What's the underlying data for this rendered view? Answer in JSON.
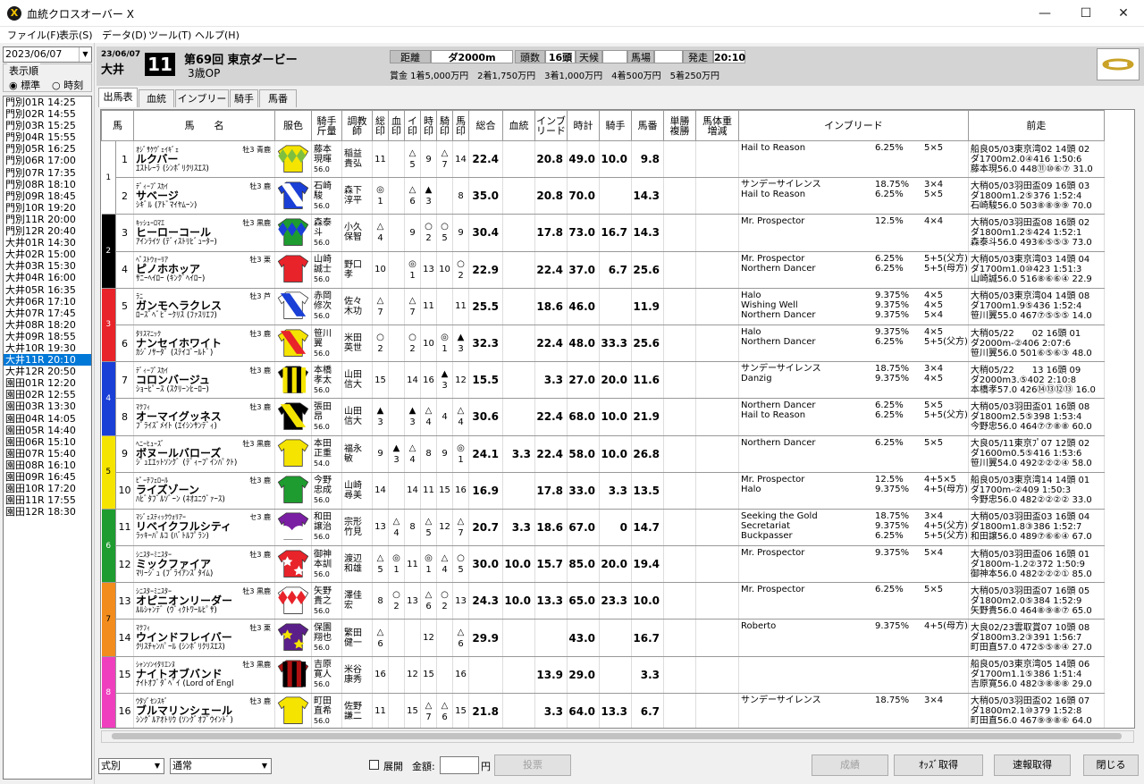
{
  "window": {
    "title": "血統クロスオーバー X",
    "minimize": "—",
    "maximize": "☐",
    "close": "✕"
  },
  "menu": [
    "ファイル(F)",
    "表示(S)",
    "データ(D)",
    "ツール(T)",
    "ヘルプ(H)"
  ],
  "left": {
    "date": "2023/06/07",
    "order_label": "表示順",
    "order_opts": [
      "標準",
      "時刻"
    ],
    "races": [
      "門別01R 14:25",
      "門別02R 14:55",
      "門別03R 15:25",
      "門別04R 15:55",
      "門別05R 16:25",
      "門別06R 17:00",
      "門別07R 17:35",
      "門別08R 18:10",
      "門別09R 18:45",
      "門別10R 19:20",
      "門別11R 20:00",
      "門別12R 20:40",
      "大井01R 14:30",
      "大井02R 15:00",
      "大井03R 15:30",
      "大井04R 16:00",
      "大井05R 16:35",
      "大井06R 17:10",
      "大井07R 17:45",
      "大井08R 18:20",
      "大井09R 18:55",
      "大井10R 19:30",
      "大井11R 20:10",
      "大井12R 20:50",
      "園田01R 12:20",
      "園田02R 12:55",
      "園田03R 13:30",
      "園田04R 14:05",
      "園田05R 14:40",
      "園田06R 15:10",
      "園田07R 15:40",
      "園田08R 16:10",
      "園田09R 16:45",
      "園田10R 17:20",
      "園田11R 17:55",
      "園田12R 18:30"
    ],
    "selected": 22
  },
  "race": {
    "date": "23/06/07",
    "venue": "大井",
    "no": "11",
    "name": "第69回 東京ダービー",
    "class": "3歳OP",
    "labels": {
      "dist": "距離",
      "heads": "頭数",
      "weather": "天候",
      "track": "馬場",
      "start": "発走"
    },
    "dist": "ダ2000m",
    "heads": "16頭",
    "weather": "",
    "track": "",
    "start": "20:10",
    "prize": "賞金 1着5,000万円　2着1,750万円　3着1,000万円　4着500万円　5着250万円"
  },
  "tabs": [
    "出馬表",
    "血統",
    "インブリード",
    "騎手",
    "馬番"
  ],
  "headers": [
    "馬",
    "馬　　名",
    "服色",
    "騎手\n斤量",
    "調教\n師",
    "総\n印",
    "血\n印",
    "イ\n印",
    "時\n印",
    "騎\n印",
    "馬\n印",
    "総合",
    "血統",
    "インブ\nリード",
    "時計",
    "騎手",
    "馬番",
    "単勝\n複勝",
    "馬体重\n増減",
    "インブリード",
    "前走"
  ],
  "gates": [
    {
      "g": "1",
      "c": "#ffffff",
      "t": "#000"
    },
    {
      "g": "2",
      "c": "#000000",
      "t": "#fff"
    },
    {
      "g": "3",
      "c": "#e8232a",
      "t": "#fff"
    },
    {
      "g": "4",
      "c": "#1a3fd6",
      "t": "#fff"
    },
    {
      "g": "5",
      "c": "#f5e400",
      "t": "#000"
    },
    {
      "g": "6",
      "c": "#1e9c2f",
      "t": "#fff"
    },
    {
      "g": "7",
      "c": "#f28c1c",
      "t": "#000"
    },
    {
      "g": "8",
      "c": "#ef3fbf",
      "t": "#fff"
    }
  ],
  "horses": [
    {
      "no": "1",
      "furi": "ｵｼﾞｻｹｳﾞｪｲｷﾞｪ",
      "name": "ルクバー",
      "sex": "牡3 青鹿",
      "sire": "ｴｽﾄﾚｰﾗ (ｼﾝﾎﾞﾘｸﾘｽｴｽ)",
      "jockey": "藤本\n現暉",
      "w": "56.0",
      "trainer": "稲益\n貴弘",
      "m": [
        "11",
        "",
        "△\n5",
        "9",
        "△\n7",
        "14"
      ],
      "total": "22.4",
      "blood": "",
      "inb": "20.8",
      "time": "49.0",
      "jk": "10.0",
      "num": "9.8",
      "ib": [
        [
          "Hail to Reason",
          "6.25%",
          "5×5"
        ]
      ],
      "zs": [
        "船良05/03東京湾02 14頭 02",
        "ダ1700m2.0④416 1:50:6",
        "藤本現56.0 448⑪⑩⑥⑦ 31.0"
      ],
      "silk": [
        "#f5e400",
        "#7fbf3f",
        "diamond"
      ]
    },
    {
      "no": "2",
      "furi": "ﾃﾞｨｰﾌﾟｽｶｲ",
      "name": "サベージ",
      "sex": "牡3 鹿",
      "sire": "ｼｷﾞﾙ (ｱﾄﾞﾏｲﾔﾑｰﾝ)",
      "jockey": "石崎\n駿",
      "w": "56.0",
      "trainer": "森下\n淳平",
      "m": [
        "◎\n1",
        "",
        "△\n6",
        "▲\n3",
        "",
        "8"
      ],
      "total": "35.0",
      "blood": "",
      "inb": "20.8",
      "time": "70.0",
      "jk": "",
      "num": "14.3",
      "ib": [
        [
          "サンデーサイレンス",
          "18.75%",
          "3×4"
        ],
        [
          "Hail to Reason",
          "6.25%",
          "5×5"
        ]
      ],
      "zs": [
        "大稍05/03羽田盃09 16頭 03",
        "ダ1800m1.2⑤376 1:52:4",
        "石崎駿56.0 503⑧⑧⑨⑨ 70.0"
      ],
      "silk": [
        "#1a3fd6",
        "#fff",
        "sash"
      ]
    },
    {
      "no": "3",
      "furi": "ｷｯｼｭｰﾛﾏｴ",
      "name": "ヒーローコール",
      "sex": "牡3 黒鹿",
      "sire": "ｱｲﾝﾗｲﾂ (ﾃﾞｨｽﾄﾘﾋﾞｭｰﾀｰ)",
      "jockey": "森泰\n斗",
      "w": "56.0",
      "trainer": "小久\n保智",
      "m": [
        "△\n4",
        "",
        "9",
        "○\n2",
        "○\n5",
        "9"
      ],
      "total": "30.4",
      "blood": "",
      "inb": "17.8",
      "time": "73.0",
      "jk": "16.7",
      "num": "14.3",
      "ib": [
        [
          "Mr. Prospector",
          "12.5%",
          "4×4"
        ]
      ],
      "zs": [
        "大稍05/03羽田盃08 16頭 02",
        "ダ1800m1.2⑤424 1:52:1",
        "森泰斗56.0 493⑥⑤⑤③ 73.0"
      ],
      "silk": [
        "#1e9c2f",
        "#1a3fd6",
        "diamond"
      ]
    },
    {
      "no": "4",
      "furi": "ﾍﾟｽﾄｳｫｰﾘｱ",
      "name": "ピノホホッア",
      "sex": "牡3 栗",
      "sire": "ｻﾆｰﾍｲﾛｰ (ｷﾝｸﾞﾍｲﾛｰ)",
      "jockey": "山崎\n誠士",
      "w": "56.0",
      "trainer": "野口\n孝",
      "m": [
        "10",
        "",
        "◎\n1",
        "13",
        "10",
        "○\n2"
      ],
      "total": "22.9",
      "blood": "",
      "inb": "22.4",
      "time": "37.0",
      "jk": "6.7",
      "num": "25.6",
      "ib": [
        [
          "Mr. Prospector",
          "6.25%",
          "5+5(父方)"
        ],
        [
          "Northern Dancer",
          "6.25%",
          "5+5(母方)"
        ]
      ],
      "zs": [
        "大稍05/03東京湾03 14頭 04",
        "ダ1700m1.0⑩423 1:51:3",
        "山崎誠56.0 516⑧⑥⑥④ 22.9"
      ],
      "silk": [
        "#e8232a",
        "#e8232a",
        "plain"
      ]
    },
    {
      "no": "5",
      "furi": "ﾗﾆ",
      "name": "ガンモヘラクレス",
      "sex": "牡3 芦",
      "sire": "ﾛｰｽﾞﾍﾞﾋﾞｰｸﾘｽ (ﾌｧｽﾘｴﾌ)",
      "jockey": "赤岡\n修次",
      "w": "56.0",
      "trainer": "佐々\n木功",
      "m": [
        "△\n7",
        "",
        "△\n7",
        "11",
        "",
        "11"
      ],
      "total": "25.5",
      "blood": "",
      "inb": "18.6",
      "time": "46.0",
      "jk": "",
      "num": "11.9",
      "ib": [
        [
          "Halo",
          "9.375%",
          "4×5"
        ],
        [
          "Wishing Well",
          "9.375%",
          "4×5"
        ],
        [
          "Northern Dancer",
          "9.375%",
          "5×4"
        ]
      ],
      "zs": [
        "大稍05/03東京湾04 14頭 08",
        "ダ1700m1.9⑤436 1:52:4",
        "笹川翼55.0 467⑦⑤⑤⑤ 14.0"
      ],
      "silk": [
        "#fff",
        "#1a3fd6",
        "sash"
      ]
    },
    {
      "no": "6",
      "furi": "ﾀﾘｽﾏﾆｯｸ",
      "name": "ナンセイホワイト",
      "sex": "牡3 鹿",
      "sire": "ｶｼﾞﾉｻｰﾀﾞ (ｽﾃｲｺﾞｰﾙﾄﾞ)",
      "jockey": "笹川\n翼",
      "w": "56.0",
      "trainer": "米田\n英世",
      "m": [
        "○\n2",
        "",
        "○\n2",
        "10",
        "◎\n1",
        "▲\n3"
      ],
      "total": "32.3",
      "blood": "",
      "inb": "22.4",
      "time": "48.0",
      "jk": "33.3",
      "num": "25.6",
      "ib": [
        [
          "Halo",
          "9.375%",
          "4×5"
        ],
        [
          "Northern Dancer",
          "6.25%",
          "5+5(父方)"
        ]
      ],
      "zs": [
        "大稍05/22　　02 16頭 01",
        "ダ2000m-②406 2:07:6",
        "笹川翼56.0 501⑥⑤⑥③ 48.0"
      ],
      "silk": [
        "#f5e400",
        "#e8232a",
        "sash"
      ]
    },
    {
      "no": "7",
      "furi": "ﾃﾞｨｰﾌﾟｽｶｲ",
      "name": "コロンバージュ",
      "sex": "牡3 鹿",
      "sire": "ｼｮｰﾋﾟｰｽ (ｽｸﾘｰﾝﾋｰﾛｰ)",
      "jockey": "本橋\n孝太",
      "w": "56.0",
      "trainer": "山田\n信大",
      "m": [
        "15",
        "",
        "14",
        "16",
        "▲\n3",
        "12"
      ],
      "total": "15.5",
      "blood": "",
      "inb": "3.3",
      "time": "27.0",
      "jk": "20.0",
      "num": "11.6",
      "ib": [
        [
          "サンデーサイレンス",
          "18.75%",
          "3×4"
        ],
        [
          "Danzig",
          "9.375%",
          "4×5"
        ]
      ],
      "zs": [
        "大稍05/22　　13 16頭 09",
        "ダ2000m3.⑤402 2:10:8",
        "本橋孝57.0 426⑭⑬⑫⑬ 16.0"
      ],
      "silk": [
        "#000",
        "#f5e400",
        "vstripe"
      ]
    },
    {
      "no": "8",
      "furi": "ﾏｸﾌｨ",
      "name": "オーマイグッネス",
      "sex": "牡3 鹿",
      "sire": "ﾌﾞﾗｲｽﾞﾒｲﾄ (ｴｲｼﾝｻﾝﾃﾞｨ)",
      "jockey": "張田\n昂",
      "w": "56.0",
      "trainer": "山田\n信大",
      "m": [
        "▲\n3",
        "",
        "▲\n3",
        "△\n4",
        "4",
        "△\n4"
      ],
      "total": "30.6",
      "blood": "",
      "inb": "22.4",
      "time": "68.0",
      "jk": "10.0",
      "num": "21.9",
      "ib": [
        [
          "Northern Dancer",
          "6.25%",
          "5×5"
        ],
        [
          "Hail to Reason",
          "6.25%",
          "5+5(父方)"
        ]
      ],
      "zs": [
        "大稍05/03羽田盃01 16頭 08",
        "ダ1800m2.5⑤398 1:53:4",
        "今野忠56.0 464⑦⑦⑧⑧ 60.0"
      ],
      "silk": [
        "#000",
        "#f5e400",
        "sash"
      ]
    },
    {
      "no": "9",
      "furi": "ﾍﾆｰﾋｭｰｽﾞ",
      "name": "ボヌールバローズ",
      "sex": "牡3 黒鹿",
      "sire": "ｼﾞｭｴｴｯﾄｿﾝｸﾞ (ﾃﾞｨｰﾌﾟｲﾝﾊﾟｸﾄ)",
      "jockey": "本田\n正重",
      "w": "54.0",
      "trainer": "福永\n敏",
      "m": [
        "9",
        "▲\n3",
        "△\n4",
        "8",
        "9",
        "◎\n1"
      ],
      "total": "24.1",
      "blood": "3.3",
      "inb": "22.4",
      "time": "58.0",
      "jk": "10.0",
      "num": "26.8",
      "ib": [
        [
          "Northern Dancer",
          "6.25%",
          "5×5"
        ]
      ],
      "zs": [
        "大良05/11東京ﾌﾟ07 12頭 02",
        "ダ1600m0.5⑤416 1:53:6",
        "笹川翼54.0 492②②②④ 58.0"
      ],
      "silk": [
        "#f5e400",
        "#1a3fd6",
        "plain"
      ]
    },
    {
      "no": "10",
      "furi": "ﾋﾟｰﾁﾌｪﾛｰﾙ",
      "name": "ライズゾーン",
      "sex": "牡3 鹿",
      "sire": "ﾊﾋﾞﾀﾌﾞﾙｿﾞｰﾝ (ﾈｵﾕﾆｳﾞｧｰｽ)",
      "jockey": "今野\n忠成",
      "w": "56.0",
      "trainer": "山崎\n尋美",
      "m": [
        "14",
        "",
        "14",
        "11",
        "15",
        "16"
      ],
      "total": "16.9",
      "blood": "",
      "inb": "17.8",
      "time": "33.0",
      "jk": "3.3",
      "num": "13.5",
      "ib": [
        [
          "Mr. Prospector",
          "12.5%",
          "4+5×5"
        ],
        [
          "Halo",
          "9.375%",
          "4+5(母方)"
        ]
      ],
      "zs": [
        "船良05/03東京湾14 14頭 01",
        "ダ1700m-②409 1:50:3",
        "今野忠56.0 482②②②② 33.0"
      ],
      "silk": [
        "#1e9c2f",
        "#fff",
        "plain"
      ]
    },
    {
      "no": "11",
      "furi": "ﾏｼﾞｪｽﾃｨｯｸｳｫﾘｱｰ",
      "name": "リベイクフルシティ",
      "sex": "セ3 鹿",
      "sire": "ﾗｯｷｰﾊﾟﾙｺ (ﾊﾞﾄﾙﾌﾟﾗﾝ)",
      "jockey": "和田\n譲治",
      "w": "56.0",
      "trainer": "宗形\n竹見",
      "m": [
        "13",
        "△\n4",
        "8",
        "△\n5",
        "12",
        "△\n7"
      ],
      "total": "20.7",
      "blood": "3.3",
      "inb": "18.6",
      "time": "67.0",
      "jk": "0",
      "num": "14.7",
      "ib": [
        [
          "Seeking the Gold",
          "18.75%",
          "3×4"
        ],
        [
          "Secretariat",
          "9.375%",
          "4+5(父方)"
        ],
        [
          "Buckpasser",
          "6.25%",
          "5+5(父方)"
        ]
      ],
      "zs": [
        "大稍05/03羽田盃03 16頭 04",
        "ダ1800m1.8③386 1:52:7",
        "和田譲56.0 489⑦⑥⑥④ 67.0"
      ],
      "silk": [
        "#7a1fa3",
        "#fff",
        "scallop"
      ]
    },
    {
      "no": "12",
      "furi": "ｼﾆｽﾀｰﾐﾆｽﾀｰ",
      "name": "ミックファイア",
      "sex": "牡3 鹿",
      "sire": "ﾏﾘｰｼﾞｭ (ﾌﾞﾗｲｱﾝｽﾞﾀｲﾑ)",
      "jockey": "御神\n本訓",
      "w": "56.0",
      "trainer": "渡辺\n和雄",
      "m": [
        "△\n5",
        "◎\n1",
        "11",
        "◎\n1",
        "△\n4",
        "○\n5"
      ],
      "total": "30.0",
      "blood": "10.0",
      "inb": "15.7",
      "time": "85.0",
      "jk": "20.0",
      "num": "19.4",
      "ib": [
        [
          "Mr. Prospector",
          "9.375%",
          "5×4"
        ]
      ],
      "zs": [
        "大稍05/03羽田盃06 16頭 01",
        "ダ1800m-1.2②372 1:50:9",
        "御神本56.0 482②②②① 85.0"
      ],
      "silk": [
        "#e8232a",
        "#fff",
        "star"
      ]
    },
    {
      "no": "13",
      "furi": "ｼﾆｽﾀｰﾐﾆｽﾀｰ",
      "name": "オピニオンリーダー",
      "sex": "牡3 黒鹿",
      "sire": "ﾙﾙｼｬﾝﾃﾞ (ｳﾞｨｸﾄﾜｰﾙﾋﾟｻ)",
      "jockey": "矢野\n貴之",
      "w": "56.0",
      "trainer": "澤佳\n宏",
      "m": [
        "8",
        "○\n2",
        "13",
        "△\n6",
        "○\n2",
        "13"
      ],
      "total": "24.3",
      "blood": "10.0",
      "inb": "13.3",
      "time": "65.0",
      "jk": "23.3",
      "num": "10.0",
      "ib": [
        [
          "Mr. Prospector",
          "6.25%",
          "5×5"
        ]
      ],
      "zs": [
        "大稍05/03羽田盃07 16頭 05",
        "ダ1800m2.0⑤384 1:52:9",
        "矢野貴56.0 464⑧⑨⑧⑦ 65.0"
      ],
      "silk": [
        "#fff",
        "#e8232a",
        "diamond"
      ]
    },
    {
      "no": "14",
      "furi": "ﾏｸﾌｨ",
      "name": "ウインドフレイバー",
      "sex": "牡3 栗",
      "sire": "ｸﾘｽﾁｬﾝﾊﾟｰﾙ (ｼﾝﾎﾞﾘｸﾘｽｴｽ)",
      "jockey": "保園\n翔也",
      "w": "56.0",
      "trainer": "繁田\n健一",
      "m": [
        "△\n6",
        "",
        "",
        "12",
        "",
        "△\n6"
      ],
      "total": "29.9",
      "blood": "",
      "inb": "",
      "time": "43.0",
      "jk": "",
      "num": "16.7",
      "ib": [
        [
          "Roberto",
          "9.375%",
          "4+5(母方)"
        ]
      ],
      "zs": [
        "大良02/23雲取賞07 10頭 08",
        "ダ1800m3.2③391 1:56:7",
        "町田直57.0 472⑤⑤⑧④ 27.0"
      ],
      "silk": [
        "#5b1f8a",
        "#f5e400",
        "star"
      ]
    },
    {
      "no": "15",
      "furi": "ｼｬﾝｿﾝｲﾀﾘｴﾝﾇ",
      "name": "ナイトオブバンド",
      "sex": "牡3 黒鹿",
      "sire": "ﾅｲﾄｵﾌﾞﾀﾞﾍﾞｲ (Lord of Engl",
      "jockey": "吉原\n寛人",
      "w": "56.0",
      "trainer": "米谷\n康秀",
      "m": [
        "16",
        "",
        "12",
        "15",
        "",
        "16"
      ],
      "total": "",
      "blood": "",
      "inb": "13.9",
      "time": "29.0",
      "jk": "",
      "num": "3.3",
      "ib": [],
      "zs": [
        "船良05/03東京湾05 14頭 06",
        "ダ1700m1.1⑤386 1:51:4",
        "吉原寛56.0 482③⑧⑧⑧ 29.0"
      ],
      "silk": [
        "#b01010",
        "#000",
        "vstripe"
      ]
    },
    {
      "no": "16",
      "furi": "ｳﾀｿﾞｾﾝｽｷﾞ",
      "name": "ブルマリンシェール",
      "sex": "牡3 鹿",
      "sire": "ｼﾝｸﾞﾙｱｵﾄﾘｳ (ｿﾝｸﾞｵﾌﾞｳｲﾝﾄﾞ)",
      "jockey": "町田\n直希",
      "w": "56.0",
      "trainer": "佐野\n謙二",
      "m": [
        "11",
        "",
        "15",
        "△\n7",
        "△\n6",
        "15"
      ],
      "total": "21.8",
      "blood": "",
      "inb": "3.3",
      "time": "64.0",
      "jk": "13.3",
      "num": "6.7",
      "ib": [
        [
          "サンデーサイレンス",
          "18.75%",
          "3×4"
        ]
      ],
      "zs": [
        "大稍05/03羽田盃02 16頭 07",
        "ダ1800m2.1⑩379 1:52:8",
        "町田直56.0 467⑨⑨⑧⑥ 64.0"
      ],
      "silk": [
        "#f5e400",
        "#f5e400",
        "plain"
      ]
    }
  ],
  "bottom": {
    "sel1": "式別",
    "sel2": "通常",
    "expand": "展開",
    "amount_label": "金額:",
    "yen": "円",
    "bet": "投票",
    "result": "成績",
    "odds": "ｵｯｽﾞ取得",
    "flash": "速報取得",
    "close": "閉じる"
  }
}
